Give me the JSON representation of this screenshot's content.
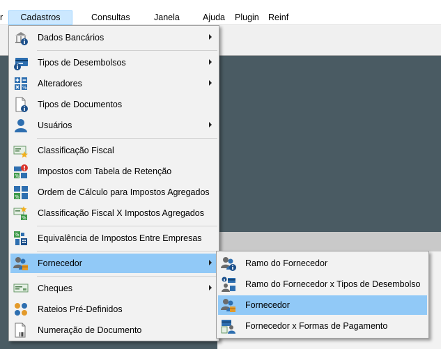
{
  "menubar": {
    "items": [
      {
        "label": "r"
      },
      {
        "label": "Cadastros"
      },
      {
        "label": "Consultas"
      },
      {
        "label": "Janela"
      },
      {
        "label": "Ajuda"
      },
      {
        "label": "Plugin"
      },
      {
        "label": "Reinf"
      }
    ]
  },
  "cadastros_menu": {
    "items": [
      {
        "label": "Dados Bancários",
        "icon": "bank-info-icon",
        "submenu": true
      },
      {
        "label": "Tipos de Desembolsos",
        "icon": "payment-types-icon",
        "submenu": true
      },
      {
        "label": "Alteradores",
        "icon": "calculator-icon",
        "submenu": true
      },
      {
        "label": "Tipos de Documentos",
        "icon": "document-info-icon",
        "submenu": false
      },
      {
        "label": "Usuários",
        "icon": "user-icon",
        "submenu": true
      },
      {
        "label": "Classificação Fiscal",
        "icon": "fiscal-classification-icon",
        "submenu": false
      },
      {
        "label": "Impostos com Tabela de Retenção",
        "icon": "tax-retention-icon",
        "submenu": false
      },
      {
        "label": "Ordem de Cálculo para Impostos Agregados",
        "icon": "tax-calc-order-icon",
        "submenu": false
      },
      {
        "label": "Classificação Fiscal X Impostos Agregados",
        "icon": "fiscal-tax-icon",
        "submenu": false
      },
      {
        "label": "Equivalência de Impostos Entre Empresas",
        "icon": "tax-equivalence-icon",
        "submenu": false
      },
      {
        "label": "Fornecedor",
        "icon": "supplier-icon",
        "submenu": true
      },
      {
        "label": "Cheques",
        "icon": "cheque-icon",
        "submenu": true
      },
      {
        "label": "Rateios Pré-Definidos",
        "icon": "allocation-icon",
        "submenu": false
      },
      {
        "label": "Numeração de Documento",
        "icon": "document-number-icon",
        "submenu": false
      }
    ]
  },
  "fornecedor_submenu": {
    "items": [
      {
        "label": "Ramo do Fornecedor",
        "icon": "supplier-branch-icon"
      },
      {
        "label": "Ramo do Fornecedor x Tipos de Desembolso",
        "icon": "supplier-branch-payment-icon"
      },
      {
        "label": "Fornecedor",
        "icon": "supplier-icon"
      },
      {
        "label": "Fornecedor x Formas de Pagamento",
        "icon": "supplier-payment-forms-icon"
      }
    ]
  },
  "colors": {
    "menu_bg": "#f2f2f2",
    "highlight": "#91c9f7",
    "menubar_active": "#cce8ff",
    "workspace": "#4a5b63"
  }
}
